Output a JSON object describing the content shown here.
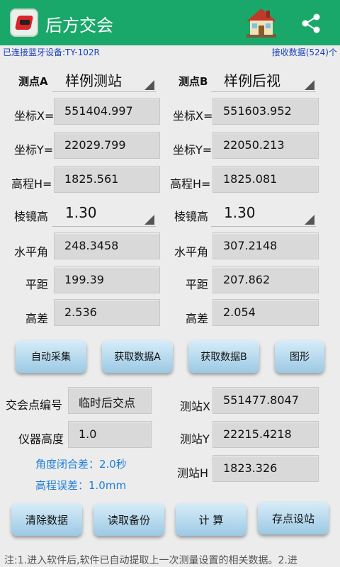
{
  "app": {
    "title": "后方交会",
    "icons": [
      "app-logo-icon",
      "home-icon",
      "share-icon"
    ]
  },
  "status": {
    "bluetooth": "已连接蓝牙设备:TY-102R",
    "received": "接收数据(524)个"
  },
  "station_a": {
    "label": "测点A",
    "name": "样例测站",
    "x_label": "坐标X=",
    "x": "551404.997",
    "y_label": "坐标Y=",
    "y": "22029.799",
    "h_label": "高程H=",
    "h": "1825.561",
    "prism_label": "棱镜高",
    "prism": "1.30",
    "angle_label": "水平角",
    "angle": "248.3458",
    "dist_label": "平距",
    "dist": "199.39",
    "diff_label": "高差",
    "diff": "2.536"
  },
  "station_b": {
    "label": "测点B",
    "name": "样例后视",
    "x_label": "坐标X=",
    "x": "551603.952",
    "y_label": "坐标Y=",
    "y": "22050.213",
    "h_label": "高程H=",
    "h": "1825.081",
    "prism_label": "棱镜高",
    "prism": "1.30",
    "angle_label": "水平角",
    "angle": "307.2148",
    "dist_label": "平距",
    "dist": "207.862",
    "diff_label": "高差",
    "diff": "2.054"
  },
  "buttons_row1": {
    "auto": "自动采集",
    "get_a": "获取数据A",
    "get_b": "获取数据B",
    "graph": "图形"
  },
  "intersection": {
    "id_label": "交会点编号",
    "id": "临时后交点",
    "inst_label": "仪器高度",
    "inst": "1.0",
    "angle_err": "角度闭合差：2.0秒",
    "height_err": "高程误差：1.0mm"
  },
  "result": {
    "x_label": "测站X",
    "x": "551477.8047",
    "y_label": "测站Y",
    "y": "22215.4218",
    "h_label": "测站H",
    "h": "1823.326"
  },
  "buttons_row2": {
    "clear": "清除数据",
    "backup": "读取备份",
    "calc": "计  算",
    "save": "存点设站"
  },
  "note": "注:1.进入软件后,软件已自动提取上一次测量设置的相关数据。2.进",
  "colors": {
    "appbar": "#1aa86a",
    "status_text": "#1a3fbf",
    "error_text": "#1e7fd8",
    "button": "#9cc9e4"
  }
}
